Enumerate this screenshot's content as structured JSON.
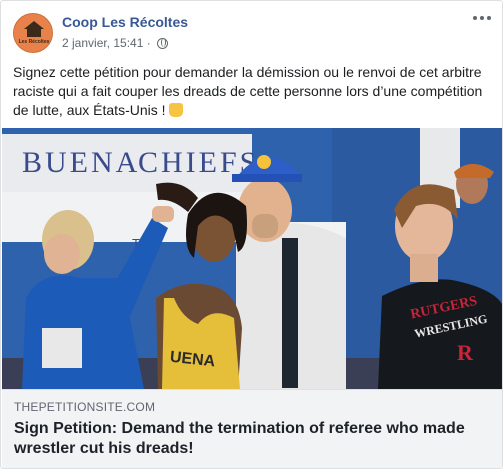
{
  "post": {
    "page_name": "Coop Les Récoltes",
    "date": "2 janvier, 15:41",
    "separator": "·",
    "avatar_text": "Les Récoltes",
    "text": "Signez cette pétition pour demander la démission ou le renvoi de cet arbitre raciste qui a fait couper les dreads de cette personne lors d’une compétition de lutte, aux États-Unis !"
  },
  "photo": {
    "banner_text_1": "BUENA",
    "banner_text_2": "CHIEFS",
    "banner_text_3": "Tin",
    "singlet_text": "UENA",
    "shirt_text_1": "RUTGERS",
    "shirt_text_2": "WRESTLING",
    "shirt_logo": "R"
  },
  "link": {
    "domain": "THEPETITIONSITE.COM",
    "title": "Sign Petition: Demand the termination of referee who made wrestler cut his dreads!"
  },
  "colors": {
    "page_name": "#385898",
    "meta": "#606770",
    "link_bg": "#f2f3f5"
  },
  "icons": [
    "globe-icon",
    "more-options-icon",
    "raised-fist-icon"
  ]
}
